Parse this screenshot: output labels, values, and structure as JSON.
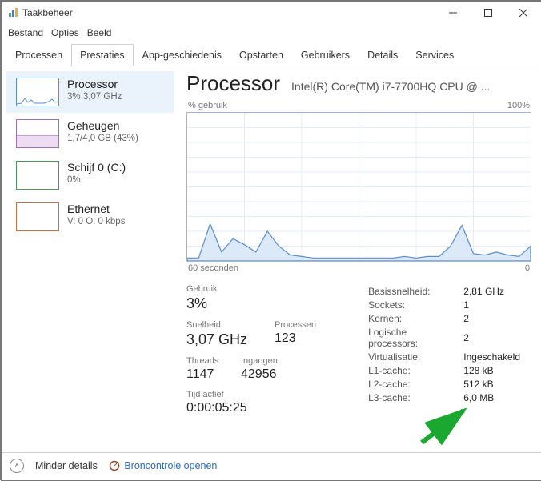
{
  "window": {
    "title": "Taakbeheer"
  },
  "menu": {
    "file": "Bestand",
    "options": "Opties",
    "view": "Beeld"
  },
  "tabs": {
    "processen": "Processen",
    "prestaties": "Prestaties",
    "app": "App-geschiedenis",
    "opstarten": "Opstarten",
    "gebruikers": "Gebruikers",
    "details": "Details",
    "services": "Services"
  },
  "sidebar": {
    "cpu": {
      "label": "Processor",
      "sub": "3% 3,07 GHz"
    },
    "mem": {
      "label": "Geheugen",
      "sub": "1,7/4,0 GB (43%)"
    },
    "disk": {
      "label": "Schijf 0 (C:)",
      "sub": "0%"
    },
    "eth": {
      "label": "Ethernet",
      "sub": "V: 0 O: 0 kbps"
    }
  },
  "main": {
    "title": "Processor",
    "model": "Intel(R) Core(TM) i7-7700HQ CPU @ ..."
  },
  "chart": {
    "y_label": "% gebruik",
    "y_max": "100%",
    "x_left": "60 seconden",
    "x_right": "0"
  },
  "stats_left": {
    "gebruik_label": "Gebruik",
    "gebruik_value": "3%",
    "snelheid_label": "Snelheid",
    "snelheid_value": "3,07 GHz",
    "processen_label": "Processen",
    "processen_value": "123",
    "threads_label": "Threads",
    "threads_value": "1147",
    "ingangen_label": "Ingangen",
    "ingangen_value": "42956",
    "uptime_label": "Tijd actief",
    "uptime_value": "0:00:05:25"
  },
  "stats_right": {
    "basis_label": "Basissnelheid:",
    "basis_val": "2,81 GHz",
    "sockets_label": "Sockets:",
    "sockets_val": "1",
    "kernen_label": "Kernen:",
    "kernen_val": "2",
    "logproc_label": "Logische processors:",
    "logproc_val": "2",
    "virt_label": "Virtualisatie:",
    "virt_val": "Ingeschakeld",
    "l1_label": "L1-cache:",
    "l1_val": "128 kB",
    "l2_label": "L2-cache:",
    "l2_val": "512 kB",
    "l3_label": "L3-cache:",
    "l3_val": "6,0 MB"
  },
  "footer": {
    "fewer": "Minder details",
    "resmon": "Broncontrole openen"
  },
  "chart_data": {
    "type": "area",
    "title": "% gebruik",
    "xlabel": "seconden",
    "ylabel": "% gebruik",
    "ylim": [
      0,
      100
    ],
    "x_range_seconds": [
      60,
      0
    ],
    "series": [
      {
        "name": "CPU",
        "x_seconds": [
          60,
          58,
          56,
          54,
          52,
          50,
          48,
          46,
          44,
          42,
          40,
          38,
          36,
          34,
          32,
          30,
          28,
          26,
          24,
          22,
          20,
          18,
          16,
          14,
          12,
          10,
          8,
          6,
          4,
          2,
          0
        ],
        "values": [
          2,
          2,
          25,
          6,
          15,
          11,
          6,
          20,
          10,
          4,
          3,
          2,
          2,
          2,
          2,
          2,
          2,
          2,
          2,
          3,
          2,
          3,
          3,
          10,
          24,
          5,
          4,
          6,
          4,
          3,
          10
        ]
      }
    ]
  }
}
